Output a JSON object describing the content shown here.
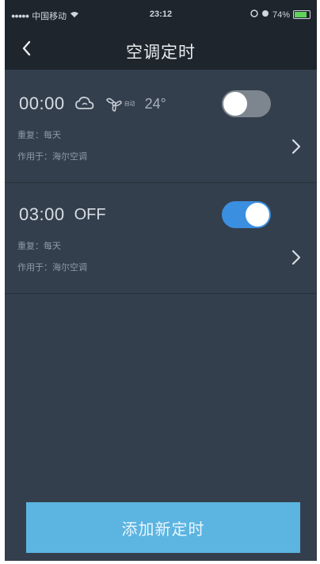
{
  "status_bar": {
    "signal_dots": "●●●●●",
    "carrier": "中国移动",
    "time": "23:12",
    "battery_percent": "74%"
  },
  "nav": {
    "title": "空调定时",
    "back_icon": "chevron-left-icon"
  },
  "timers": [
    {
      "time": "00:00",
      "mode_icon": "cloud-mode-icon",
      "fan_icon": "fan-icon",
      "fan_label": "自动",
      "temperature": "24°",
      "repeat_label": "重复：",
      "repeat_value": "每天",
      "applies_label": "作用于：",
      "applies_value": "海尔空调",
      "enabled": false
    },
    {
      "time": "03:00",
      "state": "OFF",
      "repeat_label": "重复：",
      "repeat_value": "每天",
      "applies_label": "作用于：",
      "applies_value": "海尔空调",
      "enabled": true
    }
  ],
  "add_button": {
    "label": "添加新定时"
  },
  "colors": {
    "background": "#343f4d",
    "header": "#1e252d",
    "toggle_on": "#3a8fe0",
    "toggle_off": "#7d868f",
    "add_button": "#5cb4e0"
  }
}
